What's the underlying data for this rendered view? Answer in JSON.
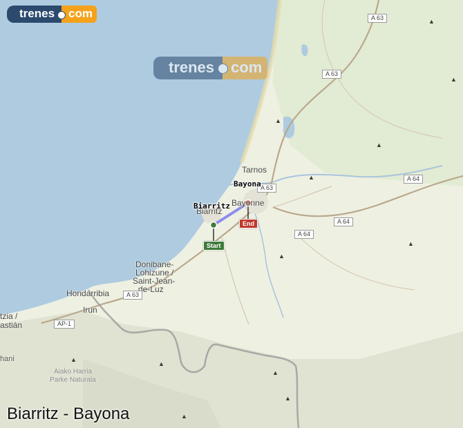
{
  "title": "Biarritz - Bayona",
  "logo": {
    "part1": "trenes",
    "part2": "com"
  },
  "watermark": {
    "part1": "trenes",
    "part2": "com"
  },
  "route": {
    "origin": "Biarritz",
    "destination": "Bayona",
    "start_label": "Start",
    "end_label": "End",
    "origin_color": "#3f7a3a",
    "destination_color": "#c0392b",
    "line_color": "#7b7bf0"
  },
  "places": {
    "tarnos": "Tarnos",
    "bayonne": "Bayonne",
    "biarritz": "Biarritz",
    "donibane": "Donibane-",
    "lohizune": "Lohizune /",
    "saint_jean": "Saint-Jean-",
    "de_luz": "de-Luz",
    "hondarribia": "Hondarribia",
    "irun": "Irun",
    "tzia": "tzia /",
    "astian": "astián",
    "hani": "hani",
    "aiako": "Aiako Harria",
    "parke": "Parke Naturala"
  },
  "roads": {
    "a63_1": "A 63",
    "a63_2": "A 63",
    "a63_3": "A 63",
    "a63_4": "A 63",
    "a64_1": "A 64",
    "a64_2": "A 64",
    "a64_3": "A 64",
    "ap1": "AP-1"
  },
  "colors": {
    "sea": "#aecbe0",
    "land": "#eef0e2",
    "mountain": "#dcdfcf",
    "forest": "#dde8cc"
  }
}
